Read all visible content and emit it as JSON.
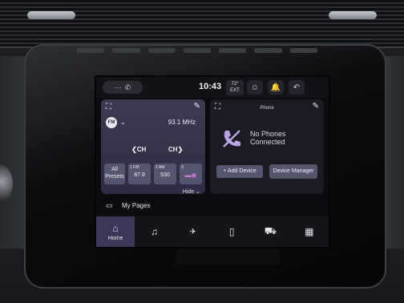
{
  "status": {
    "time": "10:43",
    "temp": "72°",
    "temp_label": "EXT"
  },
  "radio": {
    "band": "FM",
    "frequency": "93.1 MHz",
    "ch_prev": "CH",
    "ch_next": "CH",
    "hide_label": "Hide",
    "presets": [
      {
        "label": "All\nPresets"
      },
      {
        "num": "1 FM",
        "value": "87.9"
      },
      {
        "num": "2 AM",
        "value": "530"
      },
      {
        "num": "3",
        "value": ""
      }
    ]
  },
  "phone": {
    "title": "Phone",
    "message_line1": "No Phones",
    "message_line2": "Connected",
    "add_device": "+ Add Device",
    "device_manager": "Device Manager"
  },
  "mypages": {
    "label": "My Pages"
  },
  "nav": {
    "home_label": "Home"
  },
  "colors": {
    "accent": "#3a3856",
    "panel": "#2e2c42",
    "button": "#55556e",
    "phone_icon": "#b9a4e6"
  }
}
